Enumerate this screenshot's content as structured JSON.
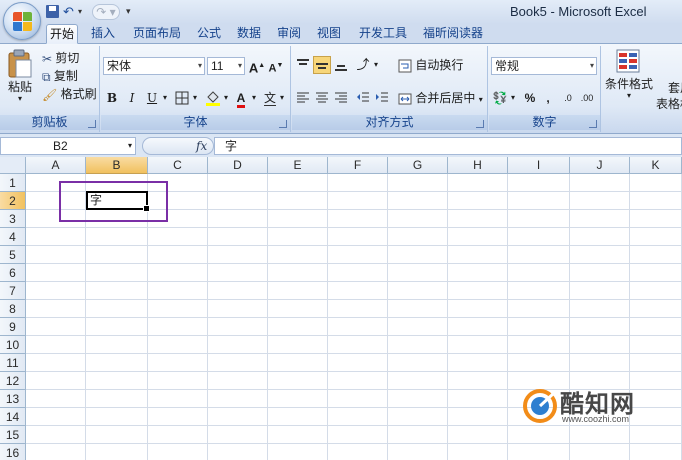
{
  "window": {
    "title": "Book5 - Microsoft Excel"
  },
  "quick_access": {
    "undo_icon": "undo-icon",
    "redo_icon": "redo-icon",
    "save_icon": "save-icon",
    "customize_icon": "customize-icon"
  },
  "tabs": [
    {
      "label": "开始",
      "active": true
    },
    {
      "label": "插入"
    },
    {
      "label": "页面布局"
    },
    {
      "label": "公式"
    },
    {
      "label": "数据"
    },
    {
      "label": "审阅"
    },
    {
      "label": "视图"
    },
    {
      "label": "开发工具"
    },
    {
      "label": "福昕阅读器"
    }
  ],
  "clipboard": {
    "paste_label": "粘贴",
    "cut_label": "剪切",
    "copy_label": "复制",
    "format_painter_label": "格式刷",
    "group_label": "剪贴板"
  },
  "font": {
    "font_name": "宋体",
    "font_size": "11",
    "grow_label": "A",
    "shrink_label": "A",
    "bold": "B",
    "italic": "I",
    "underline": "U",
    "font_color_label": "A",
    "phonetic_label": "文",
    "group_label": "字体"
  },
  "alignment": {
    "wrap_text_label": "自动换行",
    "merge_center_label": "合并后居中",
    "group_label": "对齐方式"
  },
  "number": {
    "format_value": "常规",
    "percent_label": "%",
    "comma_label": ",",
    "increase_decimal_label": ".0",
    "decrease_decimal_label": ".00",
    "group_label": "数字"
  },
  "styles": {
    "conditional_format_label": "条件格式",
    "table_format_label_1": "套用",
    "table_format_label_2": "表格格"
  },
  "formula_bar": {
    "name_box": "B2",
    "fx_label": "fx",
    "value": "字"
  },
  "grid": {
    "columns": [
      "A",
      "B",
      "C",
      "D",
      "E",
      "F",
      "G",
      "H",
      "I",
      "J",
      "K"
    ],
    "rows": [
      "1",
      "2",
      "3",
      "4",
      "5",
      "6",
      "7",
      "8",
      "9",
      "10",
      "11",
      "12",
      "13",
      "14",
      "15",
      "16"
    ],
    "selected_column": "B",
    "selected_row": "2",
    "active_cell_value": "字"
  },
  "colors": {
    "highlight": "#7a2fa6",
    "selected_header": "#f1c15f",
    "ribbon_text": "#15428b"
  },
  "watermark": {
    "brand": "酷知网",
    "url": "www.coozhi.com"
  }
}
